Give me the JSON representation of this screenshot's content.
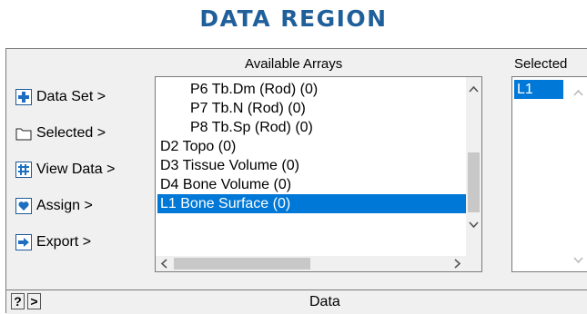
{
  "title": "DATA REGION",
  "available_header": "Available Arrays",
  "selected_header": "Selected",
  "buttons": [
    {
      "label": "Data Set >",
      "icon": "plus-icon"
    },
    {
      "label": "Selected >",
      "icon": "folder-icon"
    },
    {
      "label": "View Data >",
      "icon": "grid-icon"
    },
    {
      "label": "Assign >",
      "icon": "heart-icon"
    },
    {
      "label": "Export >",
      "icon": "arrow-right-icon"
    }
  ],
  "arrays": [
    {
      "label": "P6 Tb.Dm (Rod) (0)",
      "indent": true
    },
    {
      "label": "P7 Tb.N (Rod) (0)",
      "indent": true
    },
    {
      "label": "P8 Tb.Sp (Rod) (0)",
      "indent": true
    },
    {
      "label": "D2 Topo (0)",
      "indent": false
    },
    {
      "label": "D3 Tissue Volume (0)",
      "indent": false
    },
    {
      "label": "D4 Bone Volume (0)",
      "indent": false
    },
    {
      "label": "L1 Bone Surface (0)",
      "indent": false,
      "selected": true
    }
  ],
  "selected_items": [
    "L1"
  ],
  "status": {
    "help": "?",
    "next": ">",
    "label": "Data"
  },
  "colors": {
    "title": "#1f5f9a",
    "selection": "#0078d7",
    "panel": "#f0f0f0"
  }
}
